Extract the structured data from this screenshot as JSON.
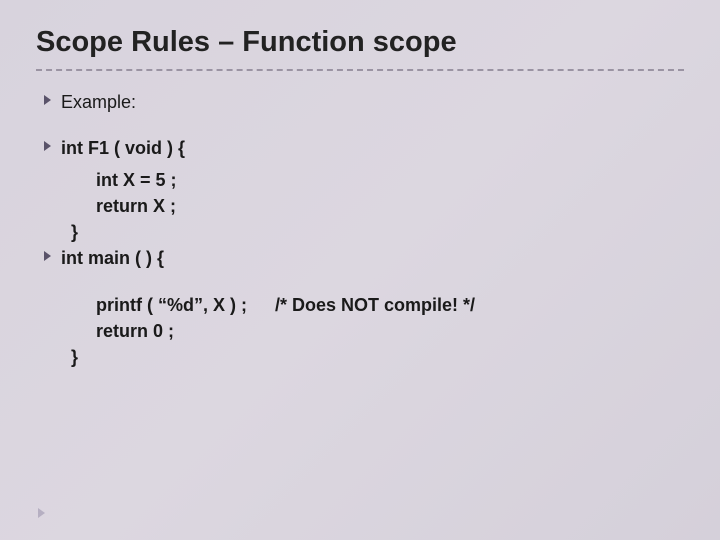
{
  "title": "Scope Rules – Function scope",
  "bullets": {
    "example": "Example:",
    "func_decl": "int F1 ( void ) {",
    "main_decl": "int main ( ) {"
  },
  "code": {
    "int_x": "int X = 5 ;",
    "return_x": "return X ;",
    "close1": "}",
    "printf": "printf ( “%d”, X ) ;",
    "comment": "/* Does NOT compile! */",
    "return0": "return 0 ;",
    "close2": "}"
  }
}
